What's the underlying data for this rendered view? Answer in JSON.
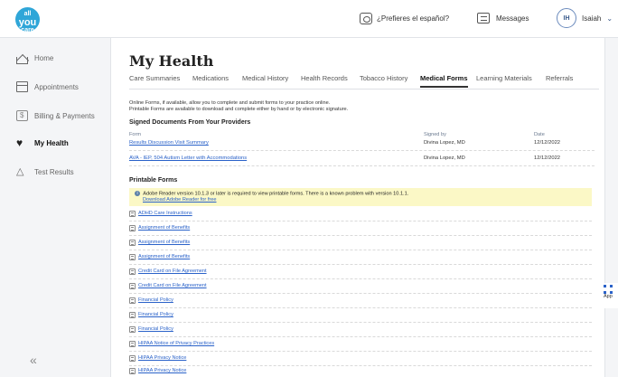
{
  "header": {
    "logo_top": "all",
    "logo_main": "you",
    "logo_bottom": "care",
    "spanish_link": "¿Prefieres el español?",
    "messages_label": "Messages",
    "user_initials": "IH",
    "user_name": "Isaiah"
  },
  "sidebar": {
    "items": [
      {
        "label": "Home",
        "icon": "home-icon"
      },
      {
        "label": "Appointments",
        "icon": "calendar-icon"
      },
      {
        "label": "Billing & Payments",
        "icon": "billing-icon"
      },
      {
        "label": "My Health",
        "icon": "heart-icon",
        "active": true
      },
      {
        "label": "Test Results",
        "icon": "flask-icon"
      }
    ],
    "collapse_label": "«"
  },
  "main": {
    "title": "My Health",
    "tabs": [
      {
        "label": "Care Summaries"
      },
      {
        "label": "Medications"
      },
      {
        "label": "Medical History"
      },
      {
        "label": "Health Records"
      },
      {
        "label": "Tobacco History"
      },
      {
        "label": "Medical Forms",
        "active": true
      },
      {
        "label": "Learning Materials"
      },
      {
        "label": "Referrals"
      }
    ],
    "intro_line1": "Online Forms, if available, allow you to complete and submit forms to your practice online.",
    "intro_line2": "Printable Forms are available to download and complete either by hand or by electronic signature.",
    "signed_heading": "Signed Documents From Your Providers",
    "columns": {
      "form": "Form",
      "signed_by": "Signed by",
      "date": "Date"
    },
    "signed_docs": [
      {
        "form": "Results Discussion Visit Summary",
        "signed_by": "Divina Lopez, MD",
        "date": "12/12/2022"
      },
      {
        "form": "AVA - IEP, 504 Autism Letter with Accommodations",
        "signed_by": "Divina Lopez, MD",
        "date": "12/12/2022"
      }
    ],
    "printable_heading": "Printable Forms",
    "notice_text": "Adobe Reader version 10.1.3 or later is required to view printable forms. There is a known problem with version 10.1.1.",
    "notice_link": "Download Adobe Reader for free",
    "printable_forms": [
      "ADHD Care Instructions",
      "Assignment of Benefits",
      "Assignment of Benefits",
      "Assignment of Benefits",
      "Credit Card on File Agreement",
      "Credit Card on File Agreement",
      "Financial Policy",
      "Financial Policy",
      "Financial Policy",
      "HIPAA Notice of Privacy Practices",
      "HIPAA Privacy Notice",
      "HIPAA Privacy Notice"
    ]
  },
  "widget": {
    "label": "App"
  },
  "colors": {
    "link": "#2a62c9",
    "notice_bg": "#fbf8c6",
    "logo": "#2fa6d8"
  }
}
